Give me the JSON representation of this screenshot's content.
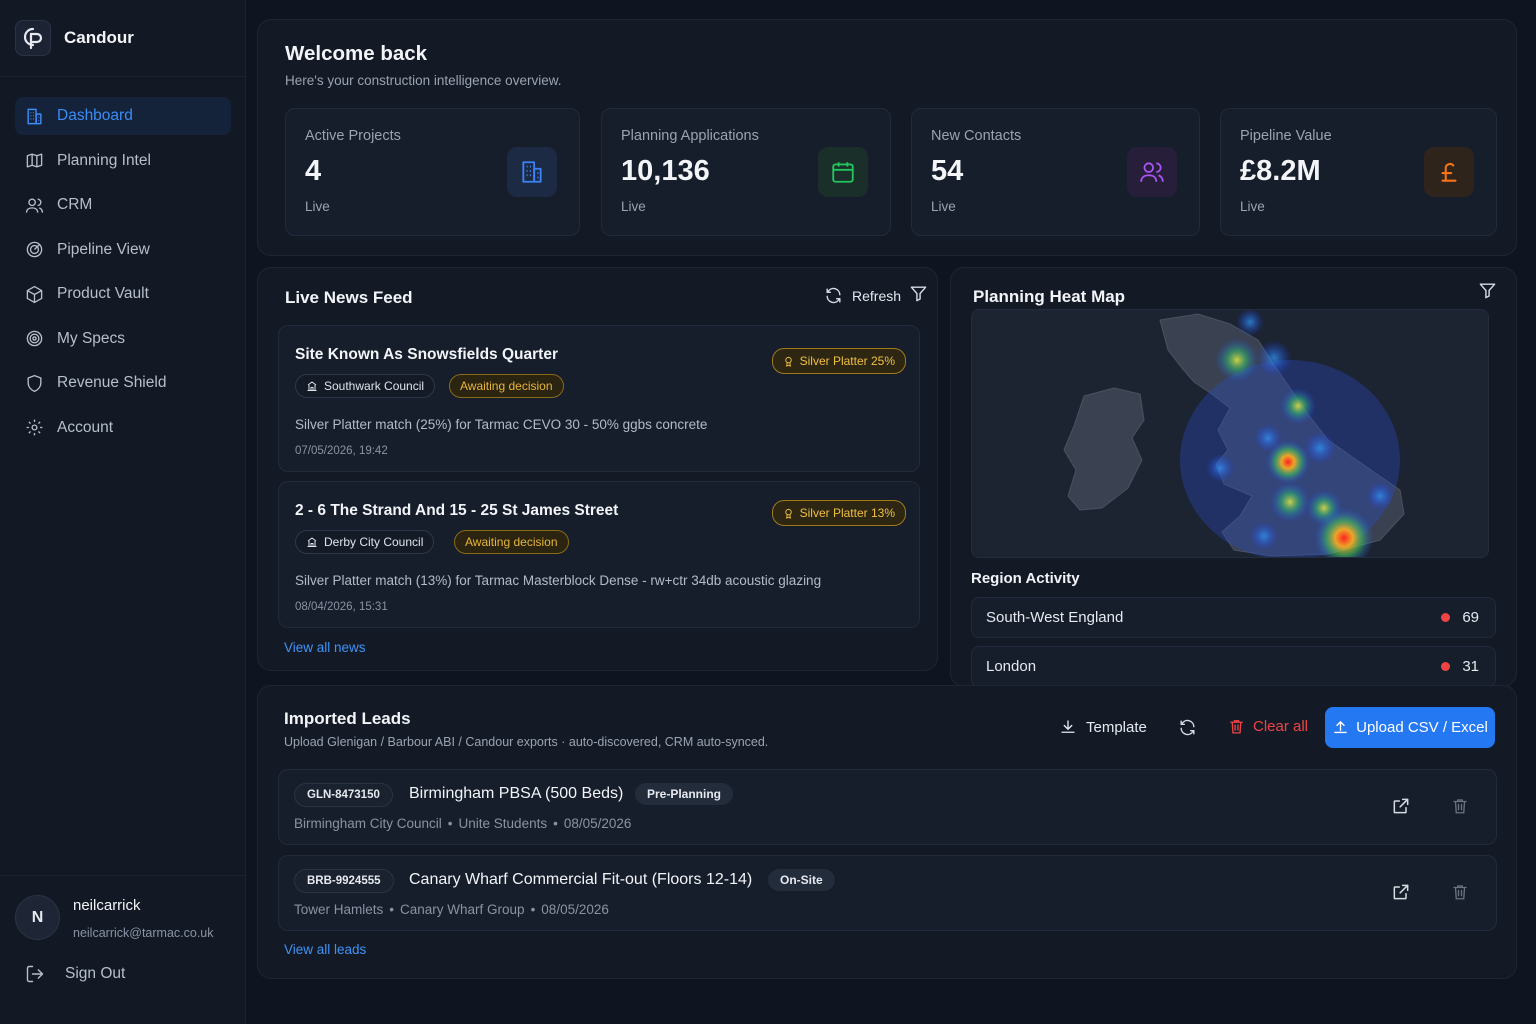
{
  "brand": {
    "name": "Candour",
    "logo_text": "CP"
  },
  "nav": [
    {
      "label": "Dashboard",
      "icon": "building-icon",
      "active": true
    },
    {
      "label": "Planning Intel",
      "icon": "map-icon"
    },
    {
      "label": "CRM",
      "icon": "users-icon"
    },
    {
      "label": "Pipeline View",
      "icon": "target-icon"
    },
    {
      "label": "Product Vault",
      "icon": "box-icon"
    },
    {
      "label": "My Specs",
      "icon": "radar-icon"
    },
    {
      "label": "Revenue Shield",
      "icon": "shield-icon"
    },
    {
      "label": "Account",
      "icon": "gear-icon"
    }
  ],
  "user": {
    "initial": "N",
    "name": "neilcarrick",
    "email": "neilcarrick@tarmac.co.uk"
  },
  "signout_label": "Sign Out",
  "welcome": {
    "title": "Welcome back",
    "subtitle": "Here's your construction intelligence overview."
  },
  "stats": [
    {
      "label": "Active Projects",
      "value": "4",
      "foot": "Live",
      "icon": "building-icon",
      "color": "#3b82f6"
    },
    {
      "label": "Planning Applications",
      "value": "10,136",
      "foot": "Live",
      "icon": "calendar-icon",
      "color": "#22c55e"
    },
    {
      "label": "New Contacts",
      "value": "54",
      "foot": "Live",
      "icon": "users-icon",
      "color": "#a855f7"
    },
    {
      "label": "Pipeline Value",
      "value": "£8.2M",
      "foot": "Live",
      "icon": "pound-icon",
      "color": "#f97316"
    }
  ],
  "news": {
    "title": "Live News Feed",
    "refresh_label": "Refresh",
    "items": [
      {
        "title": "Site Known As Snowsfields Quarter",
        "badge": "Silver Platter 25%",
        "council": "Southwark Council",
        "status": "Awaiting decision",
        "desc": "Silver Platter match (25%) for Tarmac CEVO 30 - 50% ggbs concrete",
        "date": "07/05/2026, 19:42"
      },
      {
        "title": "2 - 6 The Strand And 15 - 25 St James Street",
        "badge": "Silver Platter 13%",
        "council": "Derby City Council",
        "status": "Awaiting decision",
        "desc": "Silver Platter match (13%) for Tarmac Masterblock Dense - rw+ctr 34db acoustic glazing",
        "date": "08/04/2026, 15:31"
      }
    ],
    "view_all": "View all news"
  },
  "heatmap": {
    "title": "Planning Heat Map",
    "region_title": "Region Activity",
    "regions": [
      {
        "name": "South-West England",
        "count": "69"
      },
      {
        "name": "London",
        "count": "31"
      }
    ]
  },
  "leads": {
    "title": "Imported Leads",
    "subtitle": "Upload Glenigan / Barbour ABI / Candour exports · auto-discovered, CRM auto-synced.",
    "template_label": "Template",
    "clear_label": "Clear all",
    "upload_label": "Upload CSV / Excel",
    "items": [
      {
        "id": "GLN-8473150",
        "title": "Birmingham PBSA (500 Beds)",
        "status": "Pre-Planning",
        "council": "Birmingham City Council",
        "client": "Unite Students",
        "date": "08/05/2026"
      },
      {
        "id": "BRB-9924555",
        "title": "Canary Wharf Commercial Fit-out (Floors 12-14)",
        "status": "On-Site",
        "council": "Tower Hamlets",
        "client": "Canary Wharf Group",
        "date": "08/05/2026"
      }
    ],
    "view_all": "View all leads"
  }
}
